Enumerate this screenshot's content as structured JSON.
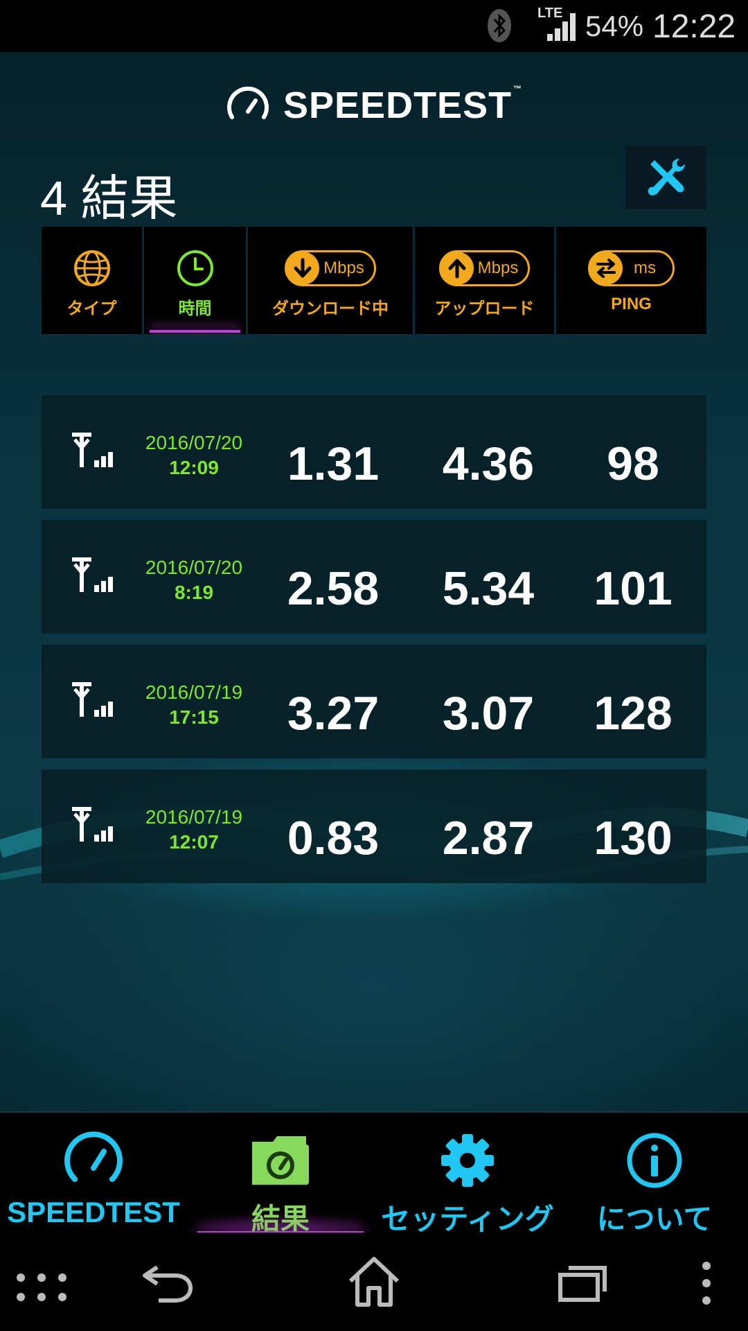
{
  "status_bar": {
    "network": "LTE",
    "battery": "54%",
    "time": "12:22"
  },
  "header": {
    "logo_text": "SPEEDTEST",
    "logo_tm": "™",
    "results_count": "4 結果",
    "tools_icon": "tools-icon"
  },
  "sort_columns": [
    {
      "label": "タイプ",
      "icon": "globe-icon"
    },
    {
      "label": "時間",
      "icon": "clock-icon",
      "active": true
    },
    {
      "label": "ダウンロード中",
      "icon": "download-arrow-icon",
      "unit": "Mbps"
    },
    {
      "label": "アップロード",
      "icon": "upload-arrow-icon",
      "unit": "Mbps"
    },
    {
      "label": "PING",
      "icon": "ping-arrows-icon",
      "unit": "ms"
    }
  ],
  "results": [
    {
      "date": "2016/07/20",
      "time": "12:09",
      "download": "1.31",
      "upload": "4.36",
      "ping": "98"
    },
    {
      "date": "2016/07/20",
      "time": "8:19",
      "download": "2.58",
      "upload": "5.34",
      "ping": "101"
    },
    {
      "date": "2016/07/19",
      "time": "17:15",
      "download": "3.27",
      "upload": "3.07",
      "ping": "128"
    },
    {
      "date": "2016/07/19",
      "time": "12:07",
      "download": "0.83",
      "upload": "2.87",
      "ping": "130"
    }
  ],
  "tabs": [
    {
      "label": "SPEEDTEST",
      "icon": "speedometer-icon"
    },
    {
      "label": "結果",
      "icon": "results-folder-icon",
      "active": true
    },
    {
      "label": "セッティング",
      "icon": "gear-icon"
    },
    {
      "label": "について",
      "icon": "info-icon"
    }
  ],
  "colors": {
    "accent_orange": "#f2a91b",
    "accent_green": "#7de82e",
    "accent_cyan": "#1fc7f2",
    "active_underline": "#c040d8"
  }
}
